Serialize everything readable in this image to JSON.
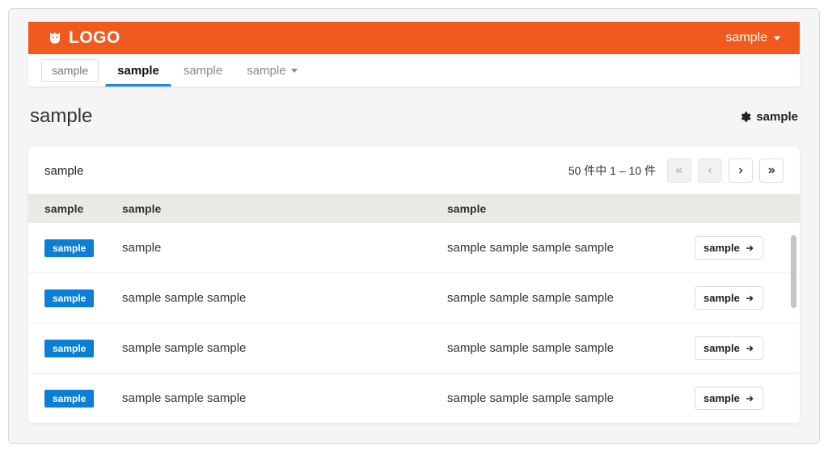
{
  "header": {
    "logo_text": "LOGO",
    "user_menu_label": "sample"
  },
  "nav": {
    "tabs": [
      {
        "label": "sample",
        "style": "boxed"
      },
      {
        "label": "sample",
        "style": "active"
      },
      {
        "label": "sample",
        "style": "normal"
      },
      {
        "label": "sample",
        "style": "dropdown"
      }
    ]
  },
  "page": {
    "title": "sample",
    "settings_label": "sample"
  },
  "panel": {
    "title": "sample",
    "pagination_info": "50 件中  1 – 10 件"
  },
  "table": {
    "headers": {
      "col1": "sample",
      "col2": "sample",
      "col3": "sample"
    },
    "rows": [
      {
        "badge": "sample",
        "name": "sample",
        "desc": "sample sample sample sample",
        "action": "sample"
      },
      {
        "badge": "sample",
        "name": "sample sample sample",
        "desc": "sample sample sample sample",
        "action": "sample"
      },
      {
        "badge": "sample",
        "name": "sample sample sample",
        "desc": "sample sample sample sample",
        "action": "sample"
      },
      {
        "badge": "sample",
        "name": "sample sample sample",
        "desc": "sample sample sample sample",
        "action": "sample"
      }
    ]
  }
}
